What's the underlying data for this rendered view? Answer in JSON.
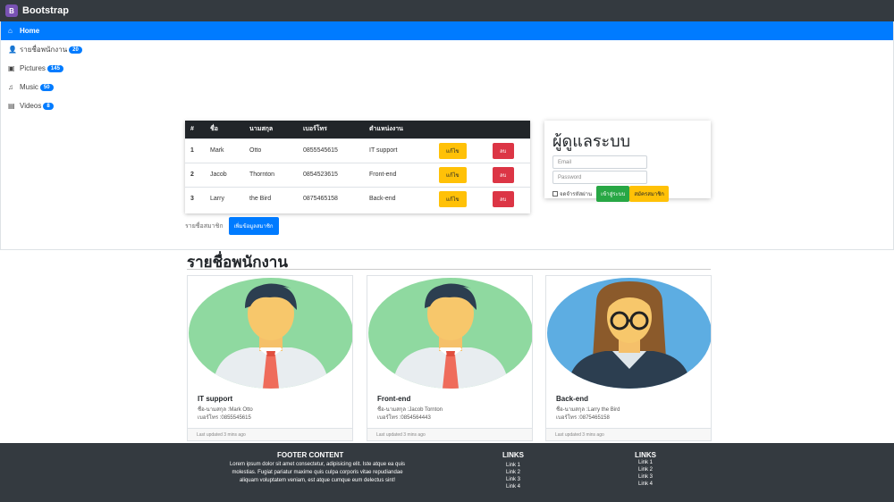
{
  "navbar": {
    "brand": "Bootstrap"
  },
  "sidebar": {
    "items": [
      {
        "icon": "home-icon",
        "label": "Home",
        "badge": ""
      },
      {
        "icon": "users-icon",
        "label": "รายชื่อพนักงาน",
        "badge": "20"
      },
      {
        "icon": "camera-icon",
        "label": "Pictures",
        "badge": "145"
      },
      {
        "icon": "music-icon",
        "label": "Music",
        "badge": "50"
      },
      {
        "icon": "film-icon",
        "label": "Videos",
        "badge": "8"
      }
    ]
  },
  "table": {
    "headers": [
      "#",
      "ชื่อ",
      "นามสกุล",
      "เบอร์โทร",
      "ตำแหน่งงาน"
    ],
    "rows": [
      {
        "num": "1",
        "first": "Mark",
        "last": "Otto",
        "phone": "0855545615",
        "position": "IT support",
        "edit": "แก้ไข",
        "delete": "ลบ"
      },
      {
        "num": "2",
        "first": "Jacob",
        "last": "Thornton",
        "phone": "0854523615",
        "position": "Front-end",
        "edit": "แก้ไข",
        "delete": "ลบ"
      },
      {
        "num": "3",
        "first": "Larry",
        "last": "the Bird",
        "phone": "0875465158",
        "position": "Back-end",
        "edit": "แก้ไข",
        "delete": "ลบ"
      }
    ]
  },
  "members": {
    "label": "รายชื่อสมาชิก",
    "add_button": "เพิ่มข้อมูลสมาชิก"
  },
  "login": {
    "title": "ผู้ดูแลระบบ",
    "email_placeholder": "Email",
    "password_placeholder": "Password",
    "remember": "จดจำรหัสผ่าน",
    "login_button": "เข้าสู่ระบบ",
    "register_button": "สมัครสมาชิก"
  },
  "section": {
    "title": "รายชื่อพนักงาน"
  },
  "cards": [
    {
      "title": "IT support",
      "line1": "ชื่อ-นามสกุล :Mark Otto",
      "line2": "เบอร์โทร :0855545615",
      "footer": "Last updated 3 mins ago",
      "avatar": "male"
    },
    {
      "title": "Front-end",
      "line1": "ชื่อ-นามสกุล :Jacob Tornton",
      "line2": "เบอร์โทร :0854564443",
      "footer": "Last updated 3 mins ago",
      "avatar": "male"
    },
    {
      "title": "Back-end",
      "line1": "ชื่อ-นามสกุล :Larry the Bird",
      "line2": "เบอร์โทร :0875465158",
      "footer": "Last updated 3 mins ago",
      "avatar": "female"
    }
  ],
  "footer": {
    "title": "FOOTER CONTENT",
    "text1": "Lorem ipsum dolor sit amet consectetur, adipisicing elit. Iste atque ea quis",
    "text2": "molestias. Fugiat pariatur maxime quis culpa corporis vitae repudiandae",
    "text3": "aliquam voluptatem veniam, est atque cumque eum delectus sint!",
    "links1": {
      "title": "LINKS",
      "items": [
        "Link 1",
        "Link 2",
        "Link 3",
        "Link 4"
      ]
    },
    "links2": {
      "title": "LINKS",
      "items": [
        "Link 1",
        "Link 2",
        "Link 3",
        "Link 4"
      ]
    }
  },
  "colors": {
    "primary": "#007bff",
    "dark": "#343a40",
    "warning": "#ffc107",
    "danger": "#dc3545",
    "success": "#28a745"
  }
}
